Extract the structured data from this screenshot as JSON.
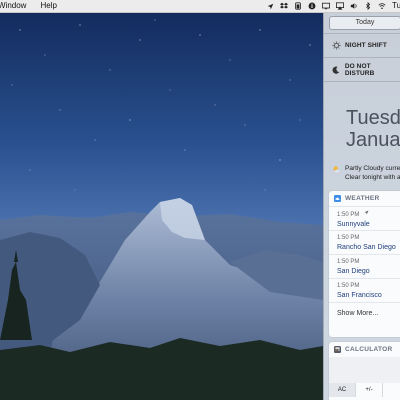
{
  "menubar": {
    "menus": [
      "Window",
      "Help"
    ],
    "status_icons": [
      "location-arrow-icon",
      "dropbox-icon",
      "battery-icon",
      "info-icon",
      "display-icon",
      "airplay-icon",
      "volume-icon",
      "bluetooth-icon",
      "wifi-icon"
    ],
    "clock": "Tu"
  },
  "notification_center": {
    "tab_today": "Today",
    "toggles": [
      {
        "label": "NIGHT SHIFT",
        "icon": "night-shift-icon"
      },
      {
        "label": "DO NOT DISTURB",
        "icon": "moon-icon"
      }
    ],
    "date": {
      "day": "Tuesday",
      "month": "January"
    },
    "forecast": {
      "icon": "partly-cloudy-icon",
      "line1": "Partly Cloudy curre",
      "line2": "Clear tonight with a"
    },
    "weather": {
      "header": "WEATHER",
      "rows": [
        {
          "time": "1:50 PM",
          "city": "Sunnyvale",
          "location": true
        },
        {
          "time": "1:50 PM",
          "city": "Rancho San Diego"
        },
        {
          "time": "1:50 PM",
          "city": "San Diego"
        },
        {
          "time": "1:50 PM",
          "city": "San Francisco"
        }
      ],
      "show_more": "Show More..."
    },
    "calculator": {
      "header": "CALCULATOR",
      "keys": [
        "AC",
        "+/-"
      ]
    }
  },
  "colors": {
    "sky_top": "#0c2350",
    "sky_bottom": "#5e86bd",
    "accent_link": "#1d3e7a"
  }
}
